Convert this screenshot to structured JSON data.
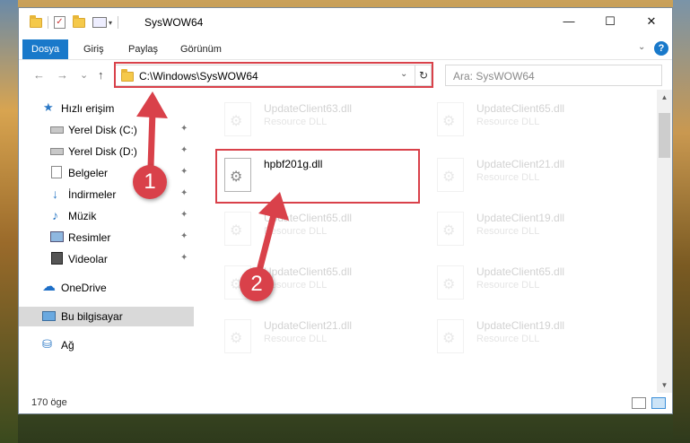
{
  "window": {
    "title": "SysWOW64",
    "min_label": "—",
    "max_label": "☐",
    "close_label": "✕"
  },
  "ribbon": {
    "tabs": [
      "Dosya",
      "Giriş",
      "Paylaş",
      "Görünüm"
    ],
    "active_tab": "Dosya",
    "help_label": "?"
  },
  "navbar": {
    "back": "←",
    "forward": "→",
    "recent": "⌄",
    "up": "↑",
    "address": "C:\\Windows\\SysWOW64",
    "address_dropdown": "⌄",
    "refresh": "↻",
    "search_placeholder": "Ara: SysWOW64"
  },
  "navpane": {
    "items": [
      {
        "label": "Hızlı erişim",
        "icon": "star-icon",
        "pinned": false
      },
      {
        "label": "Yerel Disk (C:)",
        "icon": "drive-icon",
        "pinned": true
      },
      {
        "label": "Yerel Disk (D:)",
        "icon": "drive-icon",
        "pinned": true
      },
      {
        "label": "Belgeler",
        "icon": "documents-icon",
        "pinned": true
      },
      {
        "label": "İndirmeler",
        "icon": "download-icon",
        "pinned": true
      },
      {
        "label": "Müzik",
        "icon": "music-icon",
        "pinned": true
      },
      {
        "label": "Resimler",
        "icon": "pictures-icon",
        "pinned": true
      },
      {
        "label": "Videolar",
        "icon": "videos-icon",
        "pinned": true
      },
      {
        "label": "OneDrive",
        "icon": "onedrive-icon",
        "pinned": false
      },
      {
        "label": "Bu bilgisayar",
        "icon": "this-pc-icon",
        "pinned": false
      },
      {
        "label": "Ağ",
        "icon": "network-icon",
        "pinned": false
      }
    ],
    "selected": "Bu bilgisayar",
    "pin_glyph": "📌"
  },
  "files": {
    "left": [
      {
        "name": "UpdateClient63.dll",
        "type": "Resource DLL",
        "highlighted": false
      },
      {
        "name": "hpbf201g.dll",
        "type": "",
        "highlighted": true
      },
      {
        "name": "UpdateClient65.dll",
        "type": "Resource DLL",
        "highlighted": false
      },
      {
        "name": "UpdateClient65.dll",
        "type": "Resource DLL",
        "highlighted": false
      },
      {
        "name": "UpdateClient21.dll",
        "type": "Resource DLL",
        "highlighted": false
      }
    ],
    "right": [
      {
        "name": "UpdateClient65.dll",
        "type": "Resource DLL"
      },
      {
        "name": "UpdateClient21.dll",
        "type": "Resource DLL"
      },
      {
        "name": "UpdateClient19.dll",
        "type": "Resource DLL"
      },
      {
        "name": "UpdateClient65.dll",
        "type": "Resource DLL"
      },
      {
        "name": "UpdateClient19.dll",
        "type": "Resource DLL"
      }
    ]
  },
  "statusbar": {
    "count": "170 öge"
  },
  "callouts": {
    "one": "1",
    "two": "2"
  },
  "colors": {
    "accent": "#1979ca",
    "callout_red": "#d9414a"
  }
}
